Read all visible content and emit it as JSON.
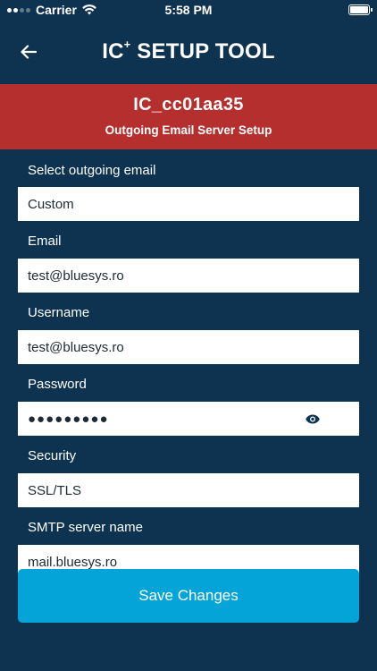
{
  "status_bar": {
    "carrier": "Carrier",
    "time": "5:58 PM",
    "icons": [
      "signal-dots-icon",
      "wifi-icon",
      "battery-icon"
    ]
  },
  "header": {
    "title_main": "IC",
    "title_sup": "+",
    "title_rest": " SETUP TOOL",
    "back_icon": "arrow-left-icon"
  },
  "banner": {
    "device_name": "IC_cc01aa35",
    "subtitle": "Outgoing Email Server Setup",
    "color": "#b42f2d"
  },
  "form": {
    "select_email": {
      "label": "Select outgoing email",
      "value": "Custom"
    },
    "email": {
      "label": "Email",
      "value": "test@bluesys.ro"
    },
    "username": {
      "label": "Username",
      "value": "test@bluesys.ro"
    },
    "password": {
      "label": "Password",
      "value": "●●●●●●●●●",
      "toggle_icon": "eye-icon"
    },
    "security": {
      "label": "Security",
      "value": "SSL/TLS"
    },
    "smtp_server": {
      "label": "SMTP server name",
      "value": "mail.bluesys.ro"
    }
  },
  "actions": {
    "save_label": "Save Changes",
    "save_color": "#04a4d8"
  },
  "theme": {
    "background": "#0d3350"
  }
}
